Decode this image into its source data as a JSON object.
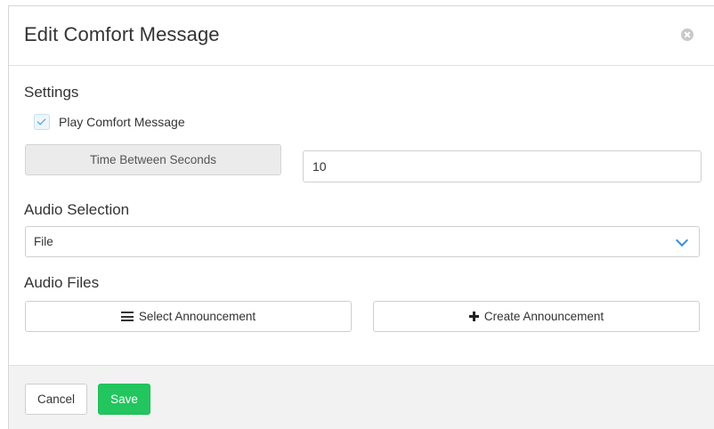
{
  "modal": {
    "title": "Edit Comfort Message",
    "close_icon": "close-circle-icon"
  },
  "settings": {
    "heading": "Settings",
    "play_comfort_message": {
      "label": "Play Comfort Message",
      "checked": true
    },
    "time_between_seconds": {
      "label": "Time Between Seconds",
      "value": "10"
    }
  },
  "audio_selection": {
    "heading": "Audio Selection",
    "selected": "File",
    "dropdown_icon": "chevron-down-icon"
  },
  "audio_files": {
    "heading": "Audio Files",
    "select_button": {
      "label": "Select Announcement",
      "icon": "list-icon"
    },
    "create_button": {
      "label": "Create Announcement",
      "icon": "plus-icon"
    }
  },
  "footer": {
    "cancel_label": "Cancel",
    "save_label": "Save"
  },
  "colors": {
    "save_button": "#22c55e",
    "accent_blue": "#3a8fd6",
    "footer_bg": "#f2f2f2"
  }
}
